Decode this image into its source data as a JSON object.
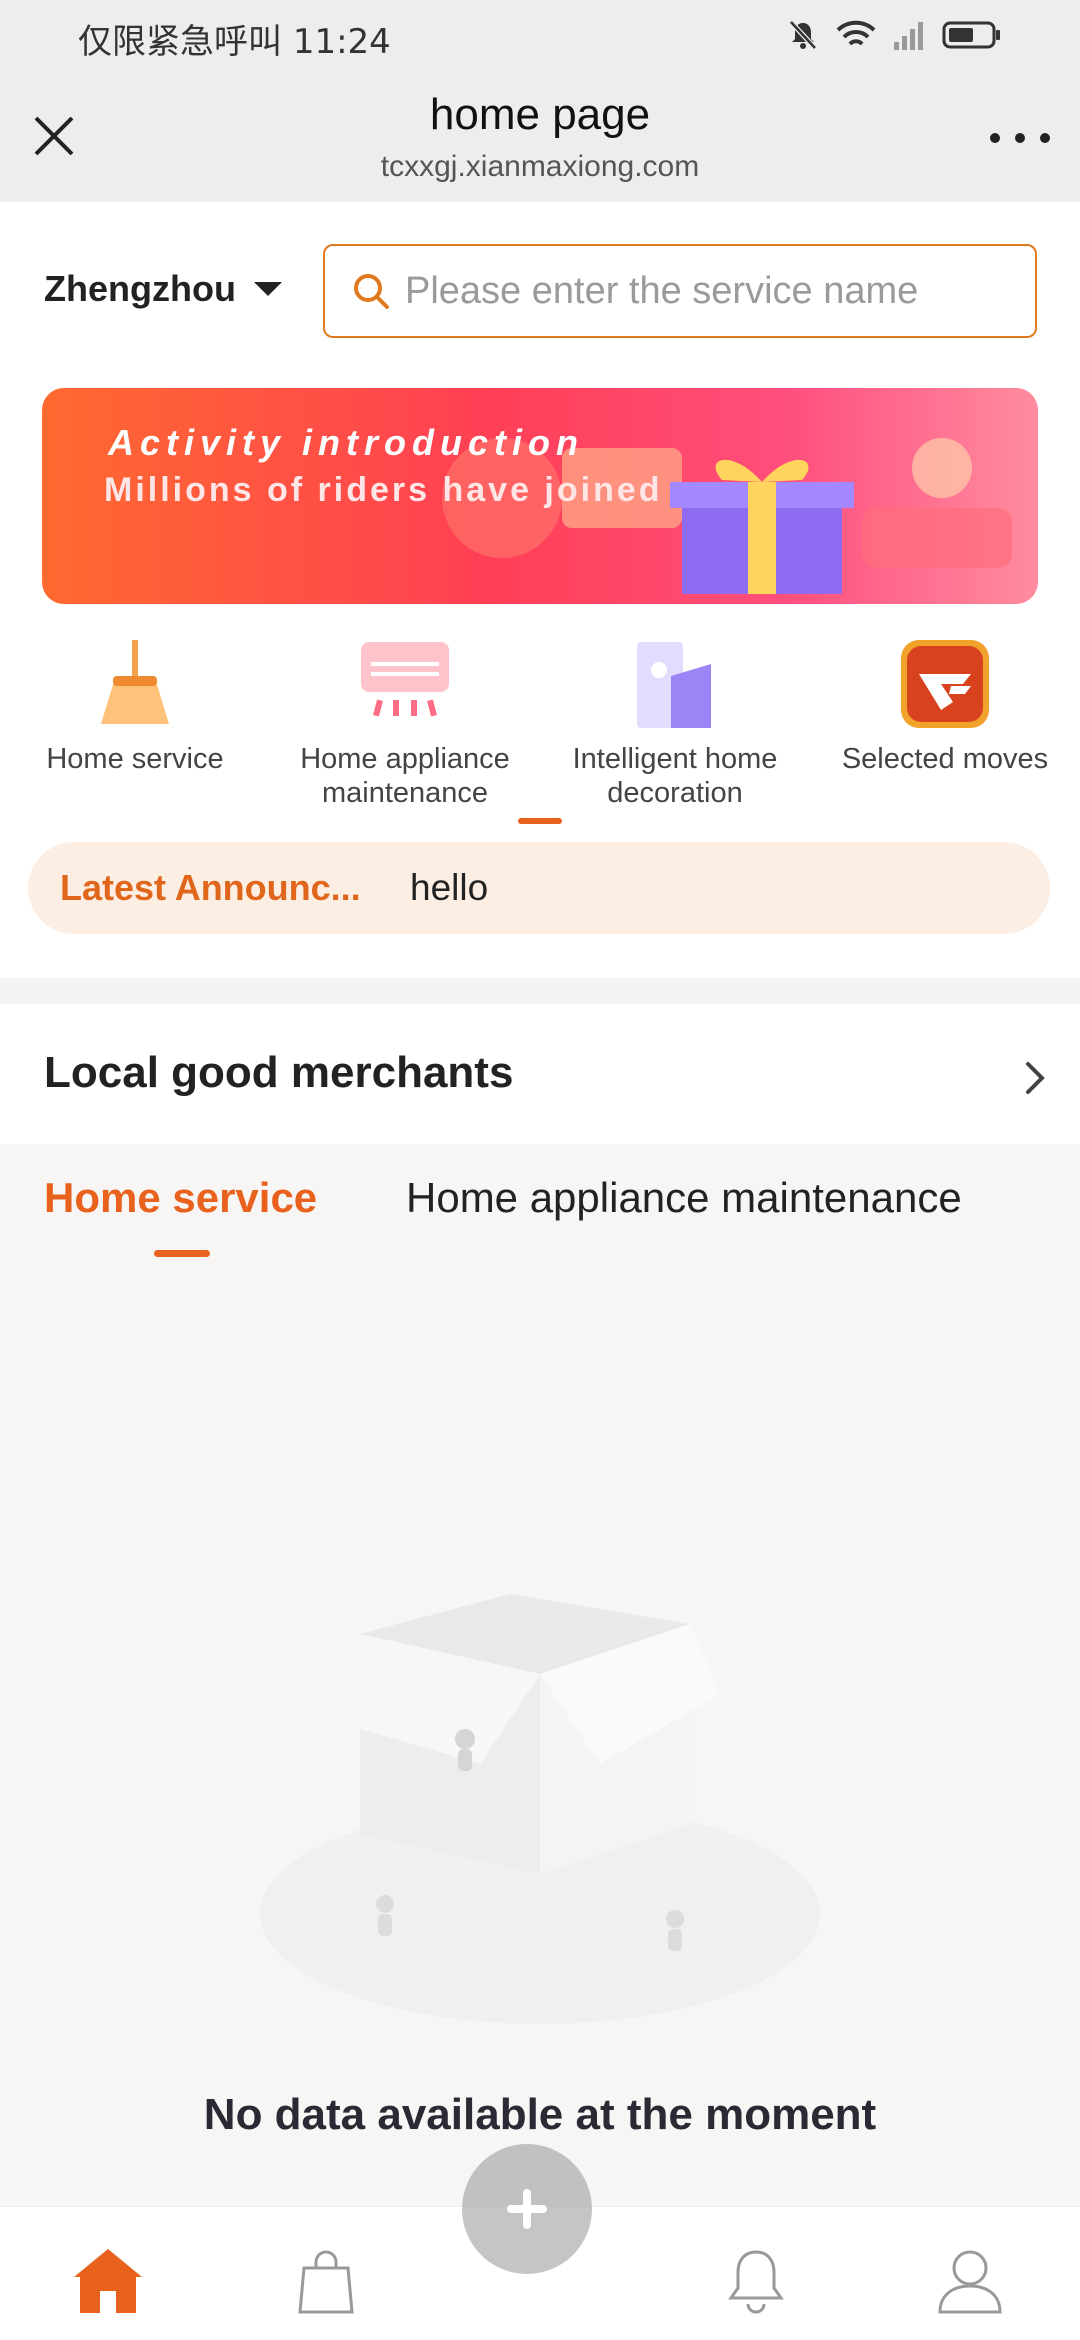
{
  "status_bar": {
    "carrier_text": "仅限紧急呼叫",
    "time": "11:24"
  },
  "browser": {
    "title": "home page",
    "url": "tcxxgj.xianmaxiong.com"
  },
  "location": {
    "city": "Zhengzhou"
  },
  "search": {
    "placeholder": "Please enter the service name",
    "value": ""
  },
  "banner": {
    "title": "Activity introduction",
    "subtitle": "Millions of riders have joined"
  },
  "categories": [
    {
      "label": "Home service",
      "icon": "broom-icon"
    },
    {
      "label": "Home appliance maintenance",
      "icon": "air-conditioner-icon"
    },
    {
      "label": "Intelligent home decoration",
      "icon": "building-icon"
    },
    {
      "label": "Selected moves",
      "icon": "moves-logo-icon"
    }
  ],
  "announcement": {
    "label": "Latest Announc...",
    "text": "hello"
  },
  "merchants": {
    "title": "Local good merchants",
    "tabs": [
      {
        "label": "Home service",
        "active": true
      },
      {
        "label": "Home appliance maintenance",
        "active": false
      }
    ],
    "empty_text": "No data available at the moment"
  },
  "bottom_nav": [
    {
      "name": "home",
      "icon": "home-icon",
      "active": true
    },
    {
      "name": "orders",
      "icon": "shopping-bag-icon",
      "active": false
    },
    {
      "name": "publish",
      "icon": "plus-icon",
      "active": false
    },
    {
      "name": "messages",
      "icon": "bell-icon",
      "active": false
    },
    {
      "name": "profile",
      "icon": "user-icon",
      "active": false
    }
  ],
  "colors": {
    "accent": "#e8621e",
    "announce_bg": "#fdeee4",
    "header_bg": "#ededed"
  }
}
